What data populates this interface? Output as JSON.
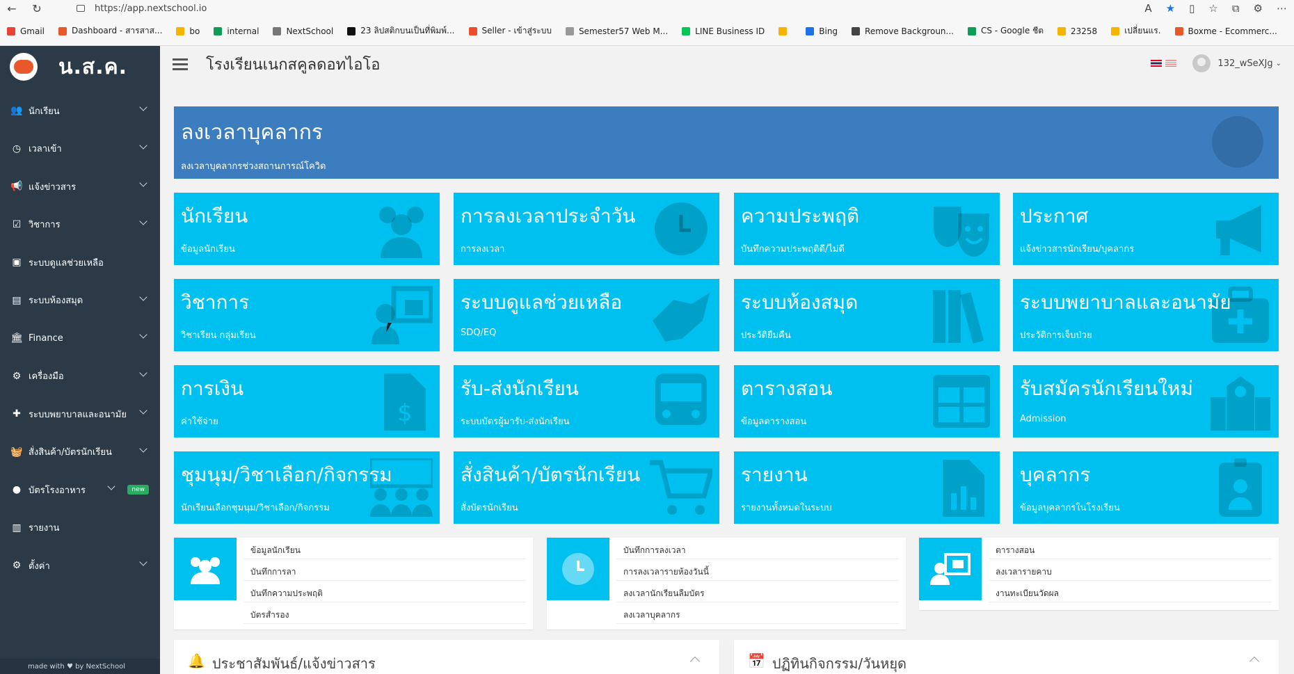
{
  "browser": {
    "url": "https://app.nextschool.io",
    "bookmarks": [
      {
        "label": "Gmail",
        "color": "#ea4335"
      },
      {
        "label": "Dashboard - สารสาส...",
        "color": "#e8582a"
      },
      {
        "label": "bo",
        "color": "#f4b400"
      },
      {
        "label": "internal",
        "color": "#0f9d58"
      },
      {
        "label": "NextSchool",
        "color": "#777777"
      },
      {
        "label": "23 ลิปสติกบนเป็นที่พิมพ์...",
        "color": "#111111"
      },
      {
        "label": "Seller - เข้าสู่ระบบ",
        "color": "#ee4d2d"
      },
      {
        "label": "Semester57 Web M...",
        "color": "#999999"
      },
      {
        "label": "LINE Business ID",
        "color": "#06c755"
      },
      {
        "label": "",
        "color": "#f4b400"
      },
      {
        "label": "Bing",
        "color": "#1a73e8"
      },
      {
        "label": "Remove Backgroun...",
        "color": "#444444"
      },
      {
        "label": "CS - Google ชีต",
        "color": "#0f9d58"
      },
      {
        "label": "23258",
        "color": "#f4b400"
      },
      {
        "label": "เปลี่ยนแร.",
        "color": "#f4b400"
      },
      {
        "label": "Boxme - Ecommerc...",
        "color": "#e8582a"
      }
    ]
  },
  "sidebar": {
    "brand": "น.ส.ค.",
    "items": [
      {
        "label": "นักเรียน",
        "icon": "users-icon",
        "glyph": "👥",
        "chevron": true
      },
      {
        "label": "เวลาเข้า",
        "icon": "clock-icon",
        "glyph": "◷",
        "chevron": true
      },
      {
        "label": "แจ้งข่าวสาร",
        "icon": "megaphone-icon",
        "glyph": "📢",
        "chevron": true
      },
      {
        "label": "วิชาการ",
        "icon": "calendar-check-icon",
        "glyph": "☑",
        "chevron": true
      },
      {
        "label": "ระบบดูแลช่วยเหลือ",
        "icon": "id-card-icon",
        "glyph": "▣",
        "chevron": false
      },
      {
        "label": "ระบบห้องสมุด",
        "icon": "book-icon",
        "glyph": "▤",
        "chevron": true
      },
      {
        "label": "Finance",
        "icon": "bank-icon",
        "glyph": "🏛",
        "chevron": true
      },
      {
        "label": "เครื่องมือ",
        "icon": "cog-icon",
        "glyph": "⚙",
        "chevron": true
      },
      {
        "label": "ระบบพยาบาลและอนามัย",
        "icon": "medkit-icon",
        "glyph": "✚",
        "chevron": true
      },
      {
        "label": "สั่งสินค้า/บัตรนักเรียน",
        "icon": "basket-icon",
        "glyph": "🧺",
        "chevron": true
      },
      {
        "label": "บัตรโรงอาหาร",
        "icon": "apple-icon",
        "glyph": "●",
        "chevron": true,
        "badge": "new"
      },
      {
        "label": "รายงาน",
        "icon": "bar-chart-icon",
        "glyph": "▥",
        "chevron": false
      },
      {
        "label": "ตั้งค่า",
        "icon": "cogs-icon",
        "glyph": "⚙",
        "chevron": true
      }
    ],
    "footer": "made with ♥ by NextSchool"
  },
  "header": {
    "school_name": "โรงเรียนเนกสคูลดอทไอโอ",
    "username": "132_wSeXJg"
  },
  "banner": {
    "title": "ลงเวลาบุคลากร",
    "subtitle": "ลงเวลาบุคลากรช่วงสถานการณ์โควิด"
  },
  "tiles": [
    {
      "title": "นักเรียน",
      "subtitle": "ข้อมูลนักเรียน",
      "icon": "users-icon"
    },
    {
      "title": "การลงเวลาประจำวัน",
      "subtitle": "การลงเวลา",
      "icon": "clock-icon"
    },
    {
      "title": "ความประพฤติ",
      "subtitle": "บันทึกความประพฤติดี/ไม่ดี",
      "icon": "theater-masks-icon"
    },
    {
      "title": "ประกาศ",
      "subtitle": "แจ้งข่าวสารนักเรียน/บุคลากร",
      "icon": "megaphone-icon"
    },
    {
      "title": "วิชาการ",
      "subtitle": "วิชาเรียน กลุ่มเรียน",
      "icon": "chalkboard-teacher-icon"
    },
    {
      "title": "ระบบดูแลช่วยเหลือ",
      "subtitle": "SDQ/EQ",
      "icon": "handshake-icon"
    },
    {
      "title": "ระบบห้องสมุด",
      "subtitle": "ประวัติยืมคืน",
      "icon": "books-icon"
    },
    {
      "title": "ระบบพยาบาลและอนามัย",
      "subtitle": "ประวัติการเจ็บป่วย",
      "icon": "medkit-icon"
    },
    {
      "title": "การเงิน",
      "subtitle": "ค่าใช้จ่าย",
      "icon": "invoice-dollar-icon"
    },
    {
      "title": "รับ-ส่งนักเรียน",
      "subtitle": "ระบบบัตรผู้มารับ-ส่งนักเรียน",
      "icon": "bus-icon"
    },
    {
      "title": "ตารางสอน",
      "subtitle": "ข้อมูลตารางสอน",
      "icon": "table-icon"
    },
    {
      "title": "รับสมัครนักเรียนใหม่",
      "subtitle": "Admission",
      "icon": "school-icon"
    },
    {
      "title": "ชุมนุม/วิชาเลือก/กิจกรรม",
      "subtitle": "นักเรียนเลือกชุมนุม/วิชาเลือก/กิจกรรม",
      "icon": "group-icon"
    },
    {
      "title": "สั่งสินค้า/บัตรนักเรียน",
      "subtitle": "สั่งบัตรนักเรียน",
      "icon": "shopping-cart-icon"
    },
    {
      "title": "รายงาน",
      "subtitle": "รายงานทั้งหมดในระบบ",
      "icon": "chart-file-icon"
    },
    {
      "title": "บุคลากร",
      "subtitle": "ข้อมูลบุคลากรในโรงเรียน",
      "icon": "id-badge-icon"
    }
  ],
  "quick": [
    {
      "icon": "users-icon",
      "links": [
        "ข้อมูลนักเรียน",
        "บันทึกการลา",
        "บันทึกความประพฤติ",
        "บัตรสำรอง"
      ]
    },
    {
      "icon": "clock-icon",
      "links": [
        "บันทึกการลงเวลา",
        "การลงเวลารายห้องวันนี้",
        "ลงเวลานักเรียนลืมบัตร",
        "ลงเวลาบุคลากร"
      ]
    },
    {
      "icon": "chalkboard-teacher-icon",
      "links": [
        "ตารางสอน",
        "ลงเวลารายคาบ",
        "งานทะเบียนวัดผล"
      ]
    }
  ],
  "panels": [
    {
      "title": "ประชาสัมพันธ์/แจ้งข่าวสาร",
      "icon": "bell-icon"
    },
    {
      "title": "ปฏิทินกิจกรรม/วันหยุด",
      "icon": "calendar-icon"
    }
  ],
  "colors": {
    "sidebar": "#2c3a47",
    "tile": "#00c0ef",
    "banner": "#3b7dbf"
  }
}
